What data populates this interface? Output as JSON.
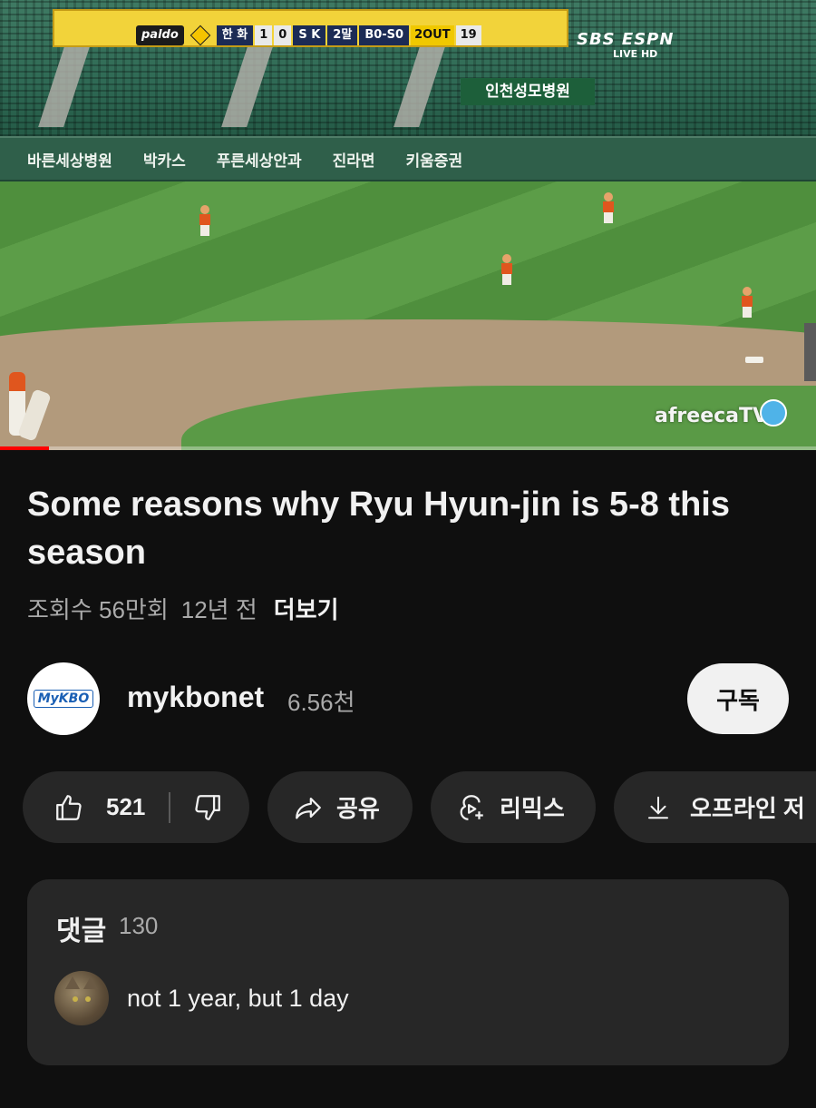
{
  "video": {
    "scorebug": {
      "sponsor_logo": "paldo",
      "team_home": "한 화",
      "score_home": "1",
      "score_away": "0",
      "team_away": "S K",
      "inning": "2말",
      "count": "B0-S0",
      "outs": "2OUT",
      "pitch_count": "19"
    },
    "broadcaster": "SBS ESPN",
    "broadcaster_sub": "LIVE HD",
    "hospital_banner": "인천성모병원",
    "ad_boards": [
      "바른세상병원",
      "박카스",
      "푸른세상안과",
      "진라면",
      "키움증권"
    ],
    "watermark": "afreecaTV",
    "progress": 0.06
  },
  "title": "Some reasons why Ryu Hyun-jin is 5-8 this season",
  "meta": {
    "views": "조회수 56만회",
    "age": "12년 전",
    "more": "더보기"
  },
  "channel": {
    "name": "mykbonet",
    "subscribers": "6.56천",
    "avatar_text": "MyKBO",
    "subscribe_label": "구독"
  },
  "actions": {
    "likes": "521",
    "share": "공유",
    "remix": "리믹스",
    "download": "오프라인 저"
  },
  "comments": {
    "header": "댓글",
    "count": "130",
    "top_comment": "not 1 year, but 1 day"
  },
  "colors": {
    "background": "#0f0f0f",
    "surface": "#272727",
    "text_primary": "#f1f1f1",
    "text_secondary": "#aaaaaa",
    "progress": "#ff0000"
  }
}
